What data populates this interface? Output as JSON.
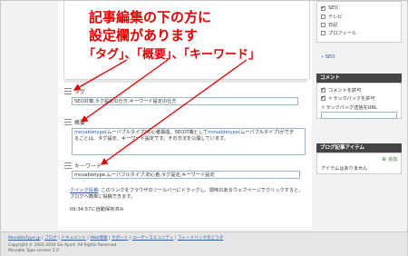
{
  "annotation": {
    "line1": "記事編集の下の方に",
    "line2": "設定欄があります",
    "line3": "「タグ」、「概要」、「キーワード」",
    "arrow_color": "#e60000"
  },
  "sections": {
    "tag": {
      "label": "タグ",
      "value": "SEO対策,タグ設定の仕方,キーワード設定の仕方"
    },
    "summary": {
      "label": "概要",
      "text_line1_kw1": "movabletype",
      "text_line1_mid": "(ムーバブルタイプ)初心者講座。SEO対策として",
      "text_line1_kw2": "movabletype",
      "text_line1_end": "(ムーバブルタイプ)ができ",
      "text_line2": "ることは、タグ設定、キーワード設定です。その方法を公開しています。"
    },
    "keywords": {
      "label": "キーワード",
      "value": "movabletype,ムーバブルタイプ,初心者,タグ設定,キーワード設定"
    }
  },
  "quickpost": {
    "link": "クイック投稿",
    "text": ": このリンクをブラウザのツールバーにドラッグし、興味のあるウェブページでクリックすると、ブログへ簡単に投稿できます。"
  },
  "autosave": "09:34:57に自動保存済み",
  "sidebar": {
    "categories": [
      {
        "label": "SEO",
        "checked": true
      },
      {
        "label": "テレビ",
        "checked": false
      },
      {
        "label": "日記",
        "checked": false
      },
      {
        "label": "プロフィール",
        "checked": false
      }
    ],
    "selected_category": "• SEO",
    "comments": {
      "title": "コメント",
      "allow_comments": "コメントを許可",
      "allow_trackbacks": "トラックバックを許可",
      "trackback_label": "トラックバック送信先URL"
    },
    "blog_items": {
      "title": "ブログ記事アイテム",
      "empty": "アイテムはありません",
      "add": "追加"
    }
  },
  "footer": {
    "links": [
      "MovableType.jp",
      "ブログ",
      "ドキュメント",
      "Web情報",
      "サポート",
      "ユーザーコミュニティ",
      "フィードバックをどうぞ"
    ],
    "copyright": "Copyright © 2001-2010 Six Apart. All Rights Reserved.",
    "version": "Movable Type version 5.0"
  },
  "colors": {
    "accent_red": "#e60000",
    "link_blue": "#2d5ea8",
    "panel_header": "#454545",
    "field_border": "#9db3d3"
  }
}
